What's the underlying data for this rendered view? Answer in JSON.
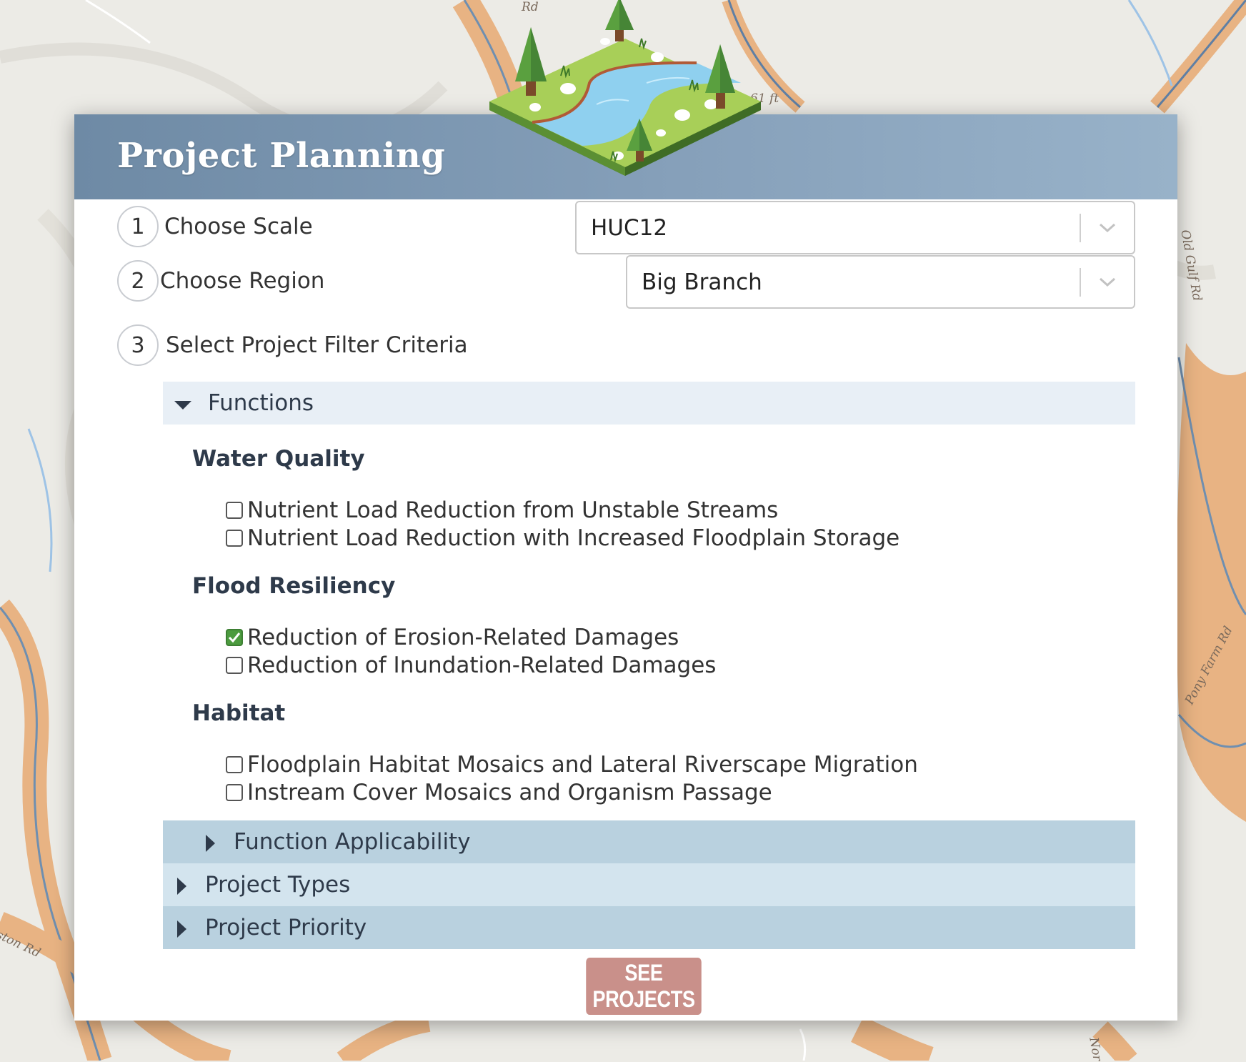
{
  "map": {
    "road_labels": [
      "Rd",
      "61 ft",
      "Pony Farm Rd",
      "ston Rd",
      "Old Gulf Rd",
      "Nor"
    ]
  },
  "panel": {
    "title": "Project Planning",
    "illustration_icon": "river-landscape-illustration"
  },
  "steps": [
    {
      "number": "1",
      "label": "Choose Scale"
    },
    {
      "number": "2",
      "label": "Choose Region"
    },
    {
      "number": "3",
      "label": "Select Project Filter Criteria"
    }
  ],
  "selects": {
    "scale": {
      "value": "HUC12"
    },
    "region": {
      "value": "Big Branch"
    }
  },
  "accordions": {
    "functions": {
      "label": "Functions",
      "expanded": true
    },
    "function_applicability": {
      "label": "Function Applicability",
      "expanded": false
    },
    "project_types": {
      "label": "Project Types",
      "expanded": false
    },
    "project_priority": {
      "label": "Project Priority",
      "expanded": false
    }
  },
  "groups": [
    {
      "heading": "Water Quality",
      "options": [
        {
          "label": "Nutrient Load Reduction from Unstable Streams",
          "checked": false
        },
        {
          "label": "Nutrient Load Reduction with Increased Floodplain Storage",
          "checked": false
        }
      ]
    },
    {
      "heading": "Flood Resiliency",
      "options": [
        {
          "label": "Reduction of Erosion-Related Damages",
          "checked": true
        },
        {
          "label": "Reduction of Inundation-Related Damages",
          "checked": false
        }
      ]
    },
    {
      "heading": "Habitat",
      "options": [
        {
          "label": "Floodplain Habitat Mosaics and Lateral Riverscape Migration",
          "checked": false
        },
        {
          "label": "Instream Cover Mosaics and Organism Passage",
          "checked": false
        }
      ]
    }
  ],
  "colors": {
    "accordion_open": "#e8eff6",
    "accordion_closed_a": "#b9d1df",
    "accordion_closed_b": "#d3e4ee",
    "button": "#c9908a",
    "checkbox_checked": "#4c9b3f"
  },
  "button": {
    "label": "SEE PROJECTS"
  }
}
